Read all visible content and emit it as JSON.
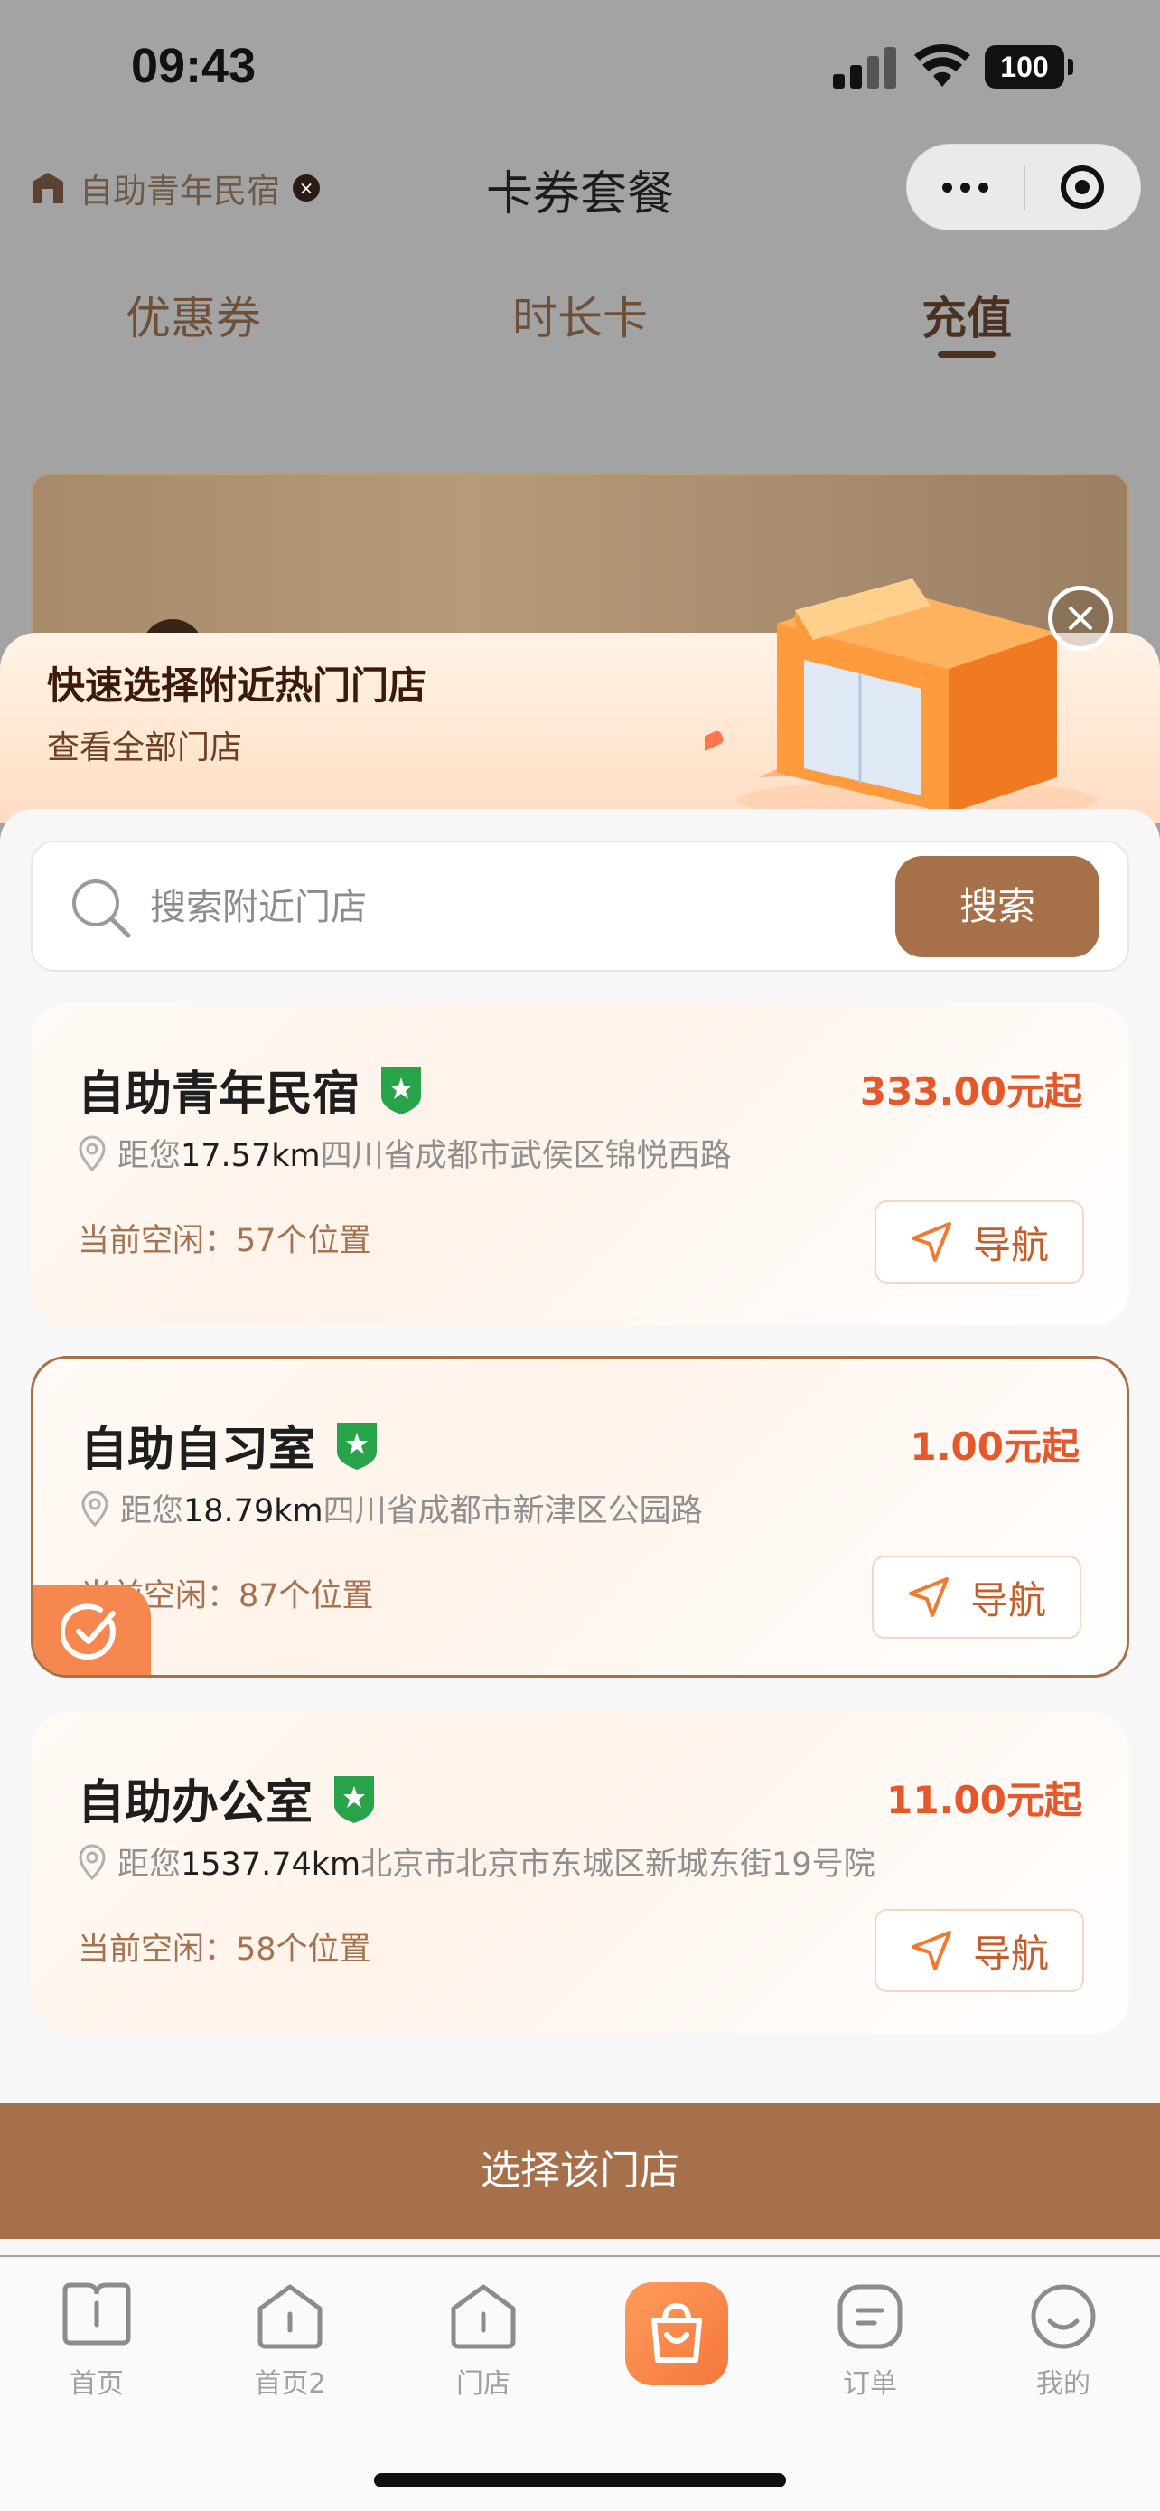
{
  "status_bar": {
    "time": "09:43",
    "battery": "100"
  },
  "nav": {
    "store_chip_label": "自助青年民宿",
    "title": "卡券套餐"
  },
  "tabs": [
    {
      "label": "优惠券",
      "active": false
    },
    {
      "label": "时长卡",
      "active": false
    },
    {
      "label": "充值",
      "active": true
    }
  ],
  "sheet": {
    "title": "快速选择附近热门门店",
    "subtitle": "查看全部门店",
    "search": {
      "placeholder": "搜索附近门店",
      "button": "搜索"
    },
    "stores": [
      {
        "name": "自助青年民宿",
        "price": "333.00元起",
        "distance_prefix": "距您",
        "distance": "17.57km",
        "address": "四川省成都市武侯区锦悦西路",
        "free": "当前空闲：57个位置",
        "nav_label": "导航",
        "selected": false
      },
      {
        "name": "自助自习室",
        "price": "1.00元起",
        "distance_prefix": "距您",
        "distance": "18.79km",
        "address": "四川省成都市新津区公园路",
        "free": "当前空闲：87个位置",
        "nav_label": "导航",
        "selected": true
      },
      {
        "name": "自助办公室",
        "price": "11.00元起",
        "distance_prefix": "距您",
        "distance": "1537.74km",
        "address": "北京市北京市东城区新城东街19号院",
        "free": "当前空闲：58个位置",
        "nav_label": "导航",
        "selected": false
      }
    ],
    "confirm_button": "选择该门店"
  },
  "tabbar": [
    {
      "label": "首页",
      "icon": "home-book-icon"
    },
    {
      "label": "首页2",
      "icon": "home-icon"
    },
    {
      "label": "门店",
      "icon": "store-icon"
    },
    {
      "label": "",
      "icon": "shopping-bag-icon"
    },
    {
      "label": "订单",
      "icon": "order-icon"
    },
    {
      "label": "我的",
      "icon": "smile-icon"
    }
  ],
  "colors": {
    "accent": "#a6704a",
    "price": "#e5582b",
    "nav_text": "#c55d2a",
    "selected_corner": "#f5874f"
  }
}
